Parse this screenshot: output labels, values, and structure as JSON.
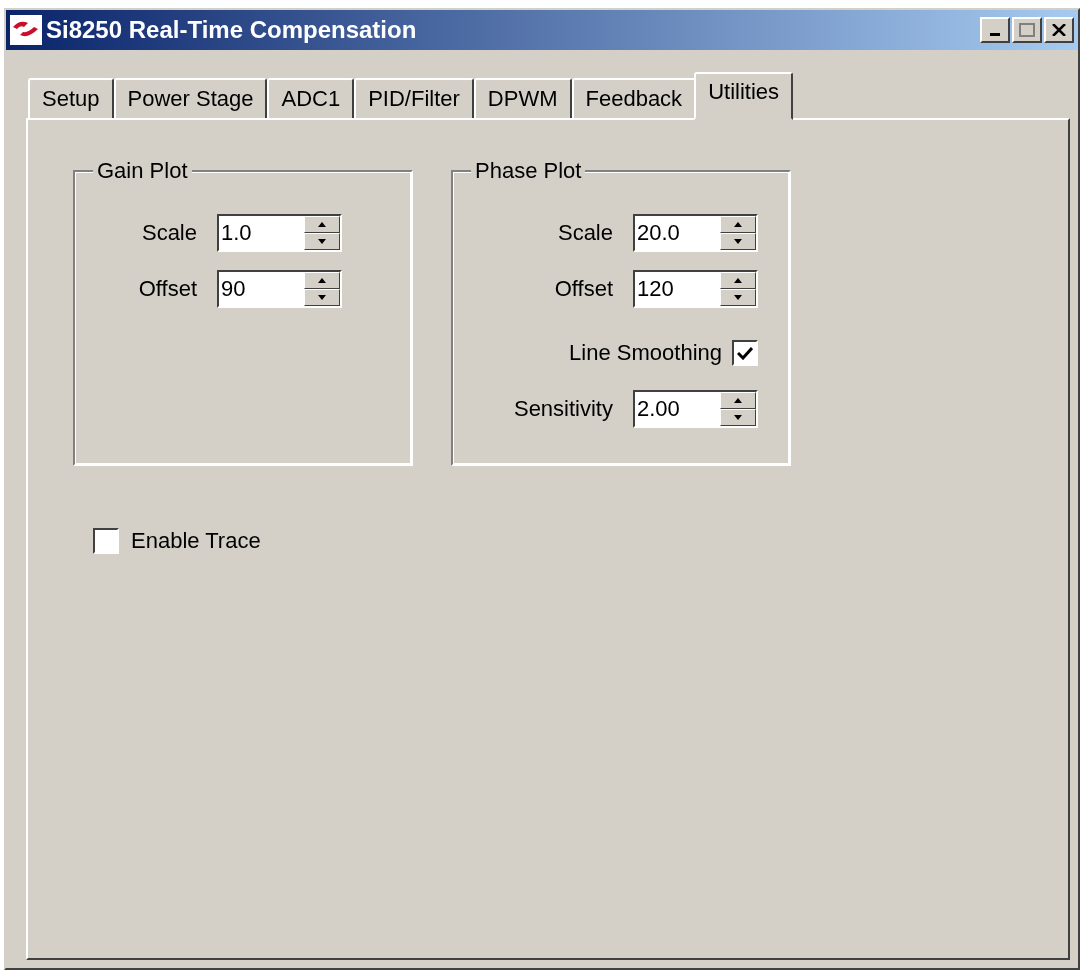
{
  "window": {
    "title": "Si8250 Real-Time Compensation"
  },
  "tabs": [
    {
      "label": "Setup",
      "selected": false
    },
    {
      "label": "Power Stage",
      "selected": false
    },
    {
      "label": "ADC1",
      "selected": false
    },
    {
      "label": "PID/Filter",
      "selected": false
    },
    {
      "label": "DPWM",
      "selected": false
    },
    {
      "label": "Feedback",
      "selected": false
    },
    {
      "label": "Utilities",
      "selected": true
    }
  ],
  "groups": [
    {
      "title": "Gain Plot",
      "rows": [
        {
          "kind": "spin",
          "label": "Scale",
          "value": "1.0"
        },
        {
          "kind": "spin",
          "label": "Offset",
          "value": "90"
        }
      ]
    },
    {
      "title": "Phase Plot",
      "rows": [
        {
          "kind": "spin",
          "label": "Scale",
          "value": "20.0"
        },
        {
          "kind": "spin",
          "label": "Offset",
          "value": "120"
        },
        {
          "kind": "checkbox",
          "label": "Line Smoothing",
          "checked": true
        },
        {
          "kind": "spin",
          "label": "Sensitivity",
          "value": "2.00"
        }
      ]
    }
  ],
  "enable_trace": {
    "label": "Enable Trace",
    "checked": false
  }
}
